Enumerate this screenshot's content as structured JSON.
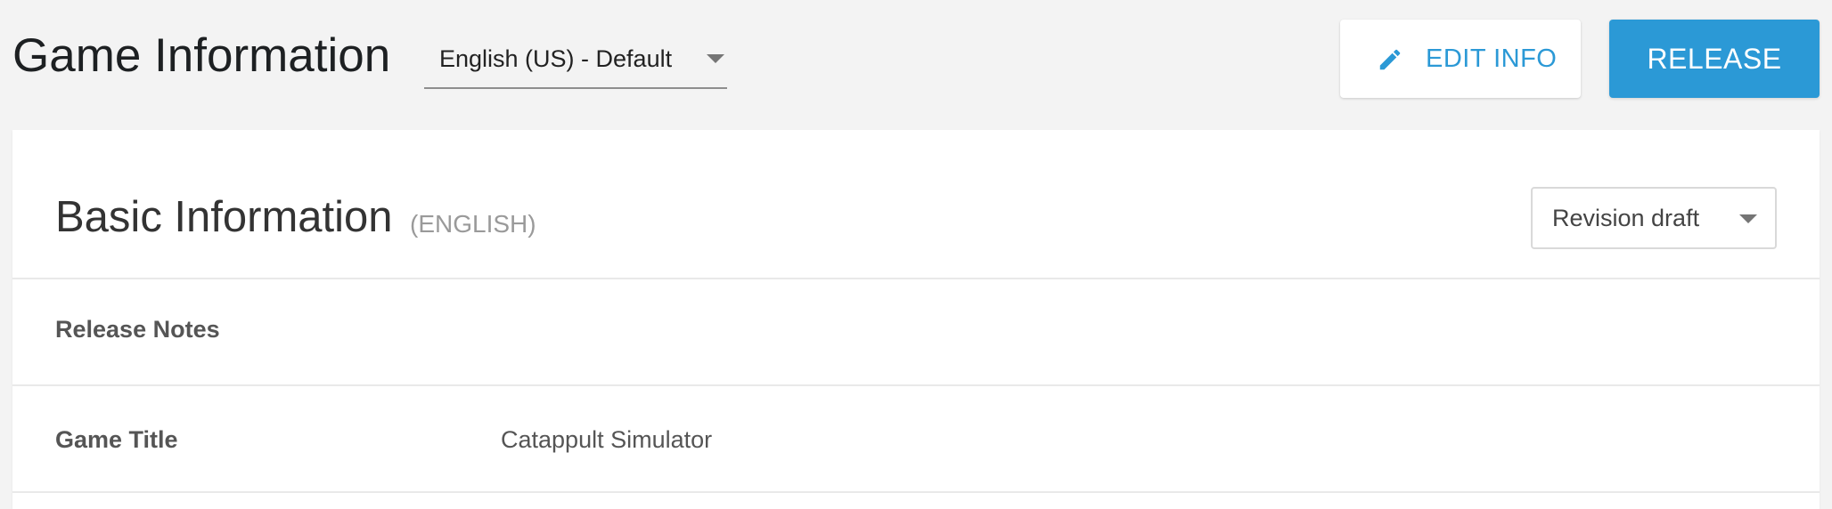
{
  "header": {
    "title": "Game Information",
    "language_select": {
      "value": "English (US) - Default"
    },
    "edit_button": {
      "label": "EDIT INFO",
      "icon": "pencil-icon"
    },
    "release_button": {
      "label": "RELEASE"
    }
  },
  "basic_info": {
    "title": "Basic Information",
    "language_tag": "(ENGLISH)",
    "revision_select": {
      "value": "Revision draft"
    },
    "rows": [
      {
        "label": "Release Notes",
        "value": ""
      },
      {
        "label": "Game Title",
        "value": "Catappult Simulator"
      }
    ]
  },
  "colors": {
    "accent": "#2b99d6",
    "background": "#f3f3f3",
    "card": "#ffffff",
    "divider": "#e9e9e9"
  }
}
